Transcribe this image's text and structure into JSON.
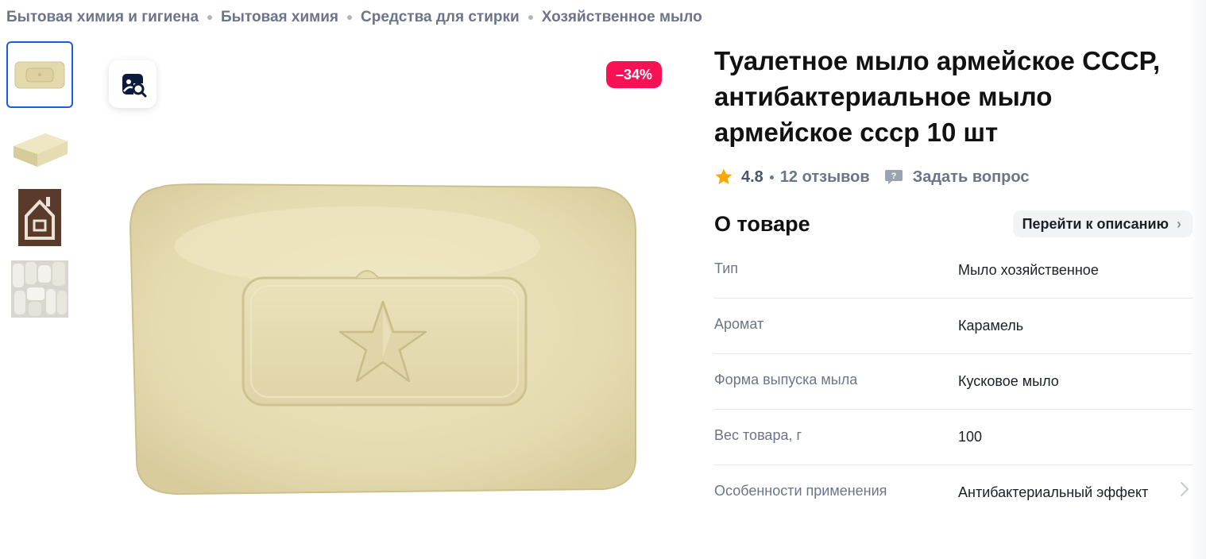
{
  "breadcrumbs": [
    "Бытовая химия и гигиена",
    "Бытовая химия",
    "Средства для стирки",
    "Хозяйственное мыло"
  ],
  "gallery": {
    "discount_badge": "–34%",
    "thumbnails": [
      "soap-front-thumb",
      "soap-angle-thumb",
      "house-pattern-thumb",
      "soap-pile-thumb"
    ]
  },
  "product": {
    "title": "Туалетное мыло армейское СССР, антибактериальное мыло армейское ссср 10 шт",
    "rating": "4.8",
    "reviews": "12 отзывов",
    "ask_question": "Задать вопрос"
  },
  "about": {
    "title": "О товаре",
    "goto_description": "Перейти к описанию",
    "properties": [
      {
        "name": "Тип",
        "value": "Мыло хозяйственное"
      },
      {
        "name": "Аромат",
        "value": "Карамель"
      },
      {
        "name": "Форма выпуска мыла",
        "value": "Кусковое мыло"
      },
      {
        "name": "Вес товара, г",
        "value": "100"
      },
      {
        "name": "Особенности применения",
        "value": "Антибактериальный эффект"
      }
    ]
  },
  "colors": {
    "accent_blue": "#1b5ce6",
    "discount_pink": "#f91155",
    "muted_text": "#6b7587",
    "star": "#ffa800",
    "soap": "#e6dcaf"
  }
}
